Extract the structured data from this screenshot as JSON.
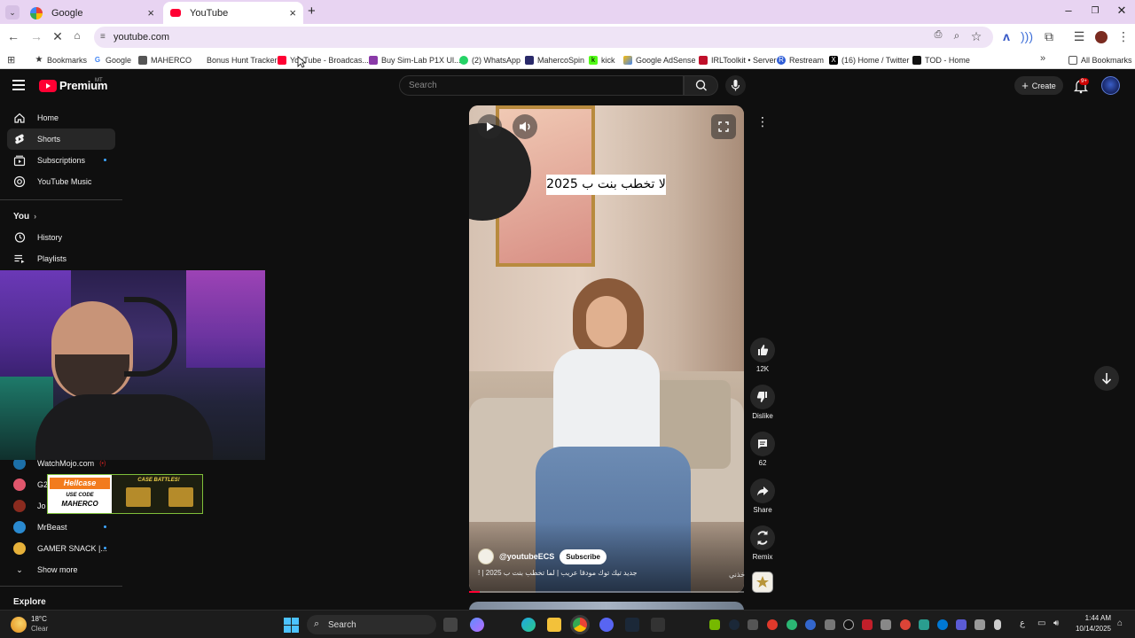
{
  "browser": {
    "tabs": [
      {
        "title": "Google",
        "favicon": "google-icon",
        "active": false
      },
      {
        "title": "YouTube",
        "favicon": "youtube-icon",
        "active": true
      }
    ],
    "address": "youtube.com",
    "bookmarks": [
      {
        "label": "Bookmarks",
        "icon": "star-icon"
      },
      {
        "label": "Google",
        "icon": "google-icon"
      },
      {
        "label": "MAHERCO",
        "icon": "maherco-icon"
      },
      {
        "label": "Bonus Hunt Tracker",
        "icon": "page-icon"
      },
      {
        "label": "YouTube - Broadcas...",
        "icon": "youtube-icon"
      },
      {
        "label": "Buy Sim-Lab P1X Ul...",
        "icon": "page-icon"
      },
      {
        "label": "(2) WhatsApp",
        "icon": "whatsapp-icon"
      },
      {
        "label": "MahercoSpin",
        "icon": "maherco-icon"
      },
      {
        "label": "kick",
        "icon": "kick-icon"
      },
      {
        "label": "Google AdSense",
        "icon": "adsense-icon"
      },
      {
        "label": "IRLToolkit • Server",
        "icon": "irl-icon"
      },
      {
        "label": "Restream",
        "icon": "restream-icon"
      },
      {
        "label": "(16) Home / Twitter",
        "icon": "x-icon"
      },
      {
        "label": "TOD - Home",
        "icon": "tod-icon"
      }
    ],
    "all_bookmarks": "All Bookmarks"
  },
  "youtube": {
    "logo_text": "Premium",
    "logo_region": "MT",
    "search_placeholder": "Search",
    "create_label": "Create",
    "notifications_badge": "9+",
    "sidebar": {
      "main": [
        {
          "label": "Home",
          "icon": "home-icon",
          "active": false
        },
        {
          "label": "Shorts",
          "icon": "shorts-icon",
          "active": true
        },
        {
          "label": "Subscriptions",
          "icon": "subscriptions-icon",
          "active": false
        },
        {
          "label": "YouTube Music",
          "icon": "youtube-music-icon",
          "active": false
        }
      ],
      "you_heading": "You",
      "you_items": [
        {
          "label": "History",
          "icon": "history-icon"
        },
        {
          "label": "Playlists",
          "icon": "playlists-icon"
        }
      ],
      "channels": [
        {
          "label": "WatchMojo.com"
        },
        {
          "label": "G2"
        },
        {
          "label": "Jo"
        },
        {
          "label": "MrBeast"
        },
        {
          "label": "GAMER SNACK |..."
        }
      ],
      "show_more": "Show more",
      "explore_heading": "Explore"
    },
    "overlay": {
      "brand": "Hellcase",
      "use_code": "USE CODE",
      "code": "MAHERCO",
      "promo": "CASE BATTLES!"
    },
    "short": {
      "caption": "لا تخطب بنت ب 2025",
      "channel": "@youtubeECS",
      "subscribe": "Subscribe",
      "title": "جديد تيك توك مودقا عريب | لما تخطب بنت ب 2025 | !",
      "sound": "خذني",
      "progress": 0.04,
      "actions": [
        {
          "label": "12K",
          "icon": "thumbs-up-icon"
        },
        {
          "label": "Dislike",
          "icon": "thumbs-down-icon"
        },
        {
          "label": "62",
          "icon": "comment-icon"
        },
        {
          "label": "Share",
          "icon": "share-icon"
        },
        {
          "label": "Remix",
          "icon": "remix-icon"
        }
      ]
    }
  },
  "taskbar": {
    "weather_temp": "18°C",
    "weather_desc": "Clear",
    "search": "Search",
    "lang": "ع",
    "time": "1:44 AM",
    "date": "10/14/2025"
  }
}
